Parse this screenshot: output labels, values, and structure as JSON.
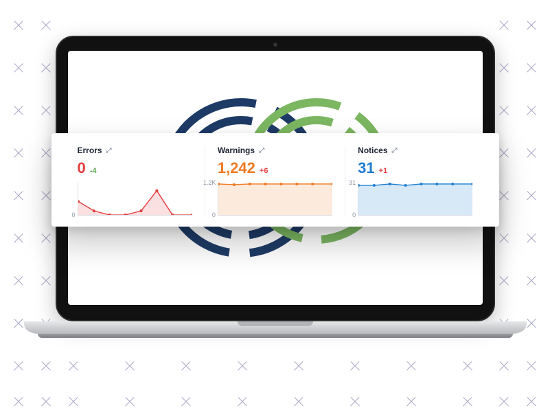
{
  "panels": {
    "errors": {
      "title": "Errors",
      "value": "0",
      "delta": "-4",
      "tick_top": "",
      "tick_bot": "0"
    },
    "warnings": {
      "title": "Warnings",
      "value": "1,242",
      "delta": "+6",
      "tick_top": "1.2K",
      "tick_bot": "0"
    },
    "notices": {
      "title": "Notices",
      "value": "31",
      "delta": "+1",
      "tick_top": "31",
      "tick_bot": "0"
    }
  },
  "chart_data": [
    {
      "type": "area",
      "name": "errors",
      "color": "#e23c3c",
      "ylim": [
        0,
        10
      ],
      "x": [
        0,
        1,
        2,
        3,
        4,
        5,
        6,
        7
      ],
      "values": [
        4,
        1,
        0,
        0,
        1,
        7,
        0,
        0
      ]
    },
    {
      "type": "area",
      "name": "warnings",
      "color": "#ef7b24",
      "ylim": [
        0,
        1200
      ],
      "x": [
        0,
        1,
        2,
        3,
        4,
        5,
        6,
        7
      ],
      "values": [
        1200,
        1190,
        1200,
        1200,
        1200,
        1200,
        1200,
        1200
      ]
    },
    {
      "type": "area",
      "name": "notices",
      "color": "#1f7fd1",
      "ylim": [
        0,
        31
      ],
      "x": [
        0,
        1,
        2,
        3,
        4,
        5,
        6,
        7
      ],
      "values": [
        30,
        30,
        31,
        30,
        31,
        31,
        31,
        31
      ]
    }
  ]
}
